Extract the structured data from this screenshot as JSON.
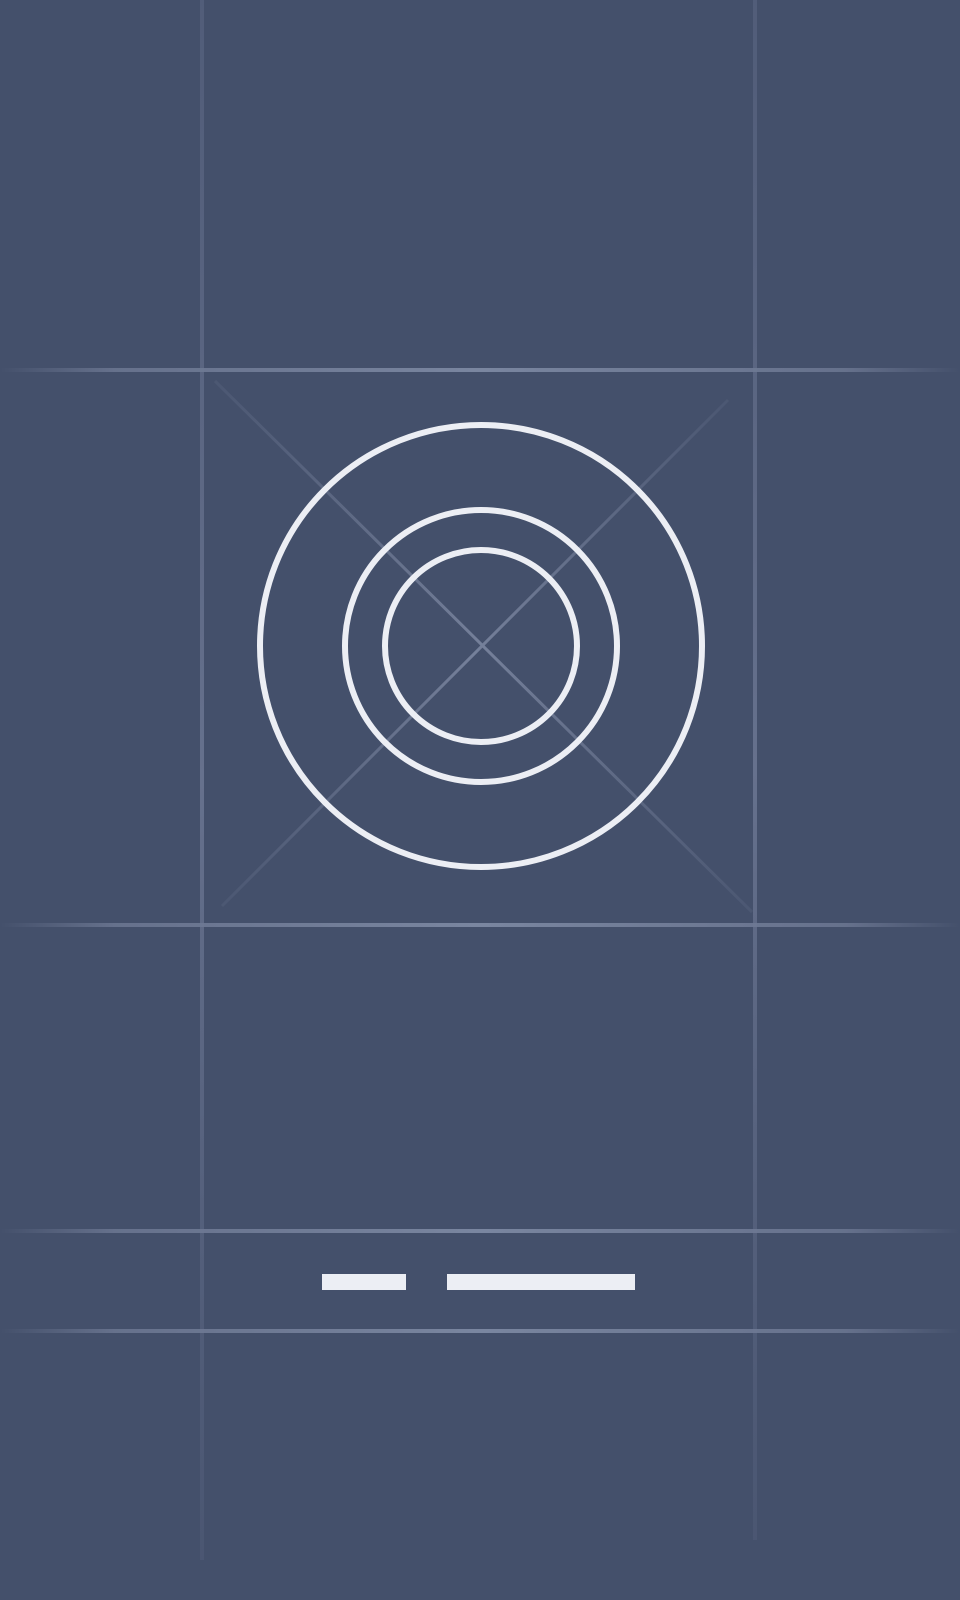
{
  "screen": {
    "background_color": "#44506b",
    "icon": "concentric-circles-icon",
    "caption_placeholder": "loading-text-placeholder"
  },
  "colors": {
    "stroke": "#eceef4",
    "grid_line": "#6a7590"
  }
}
